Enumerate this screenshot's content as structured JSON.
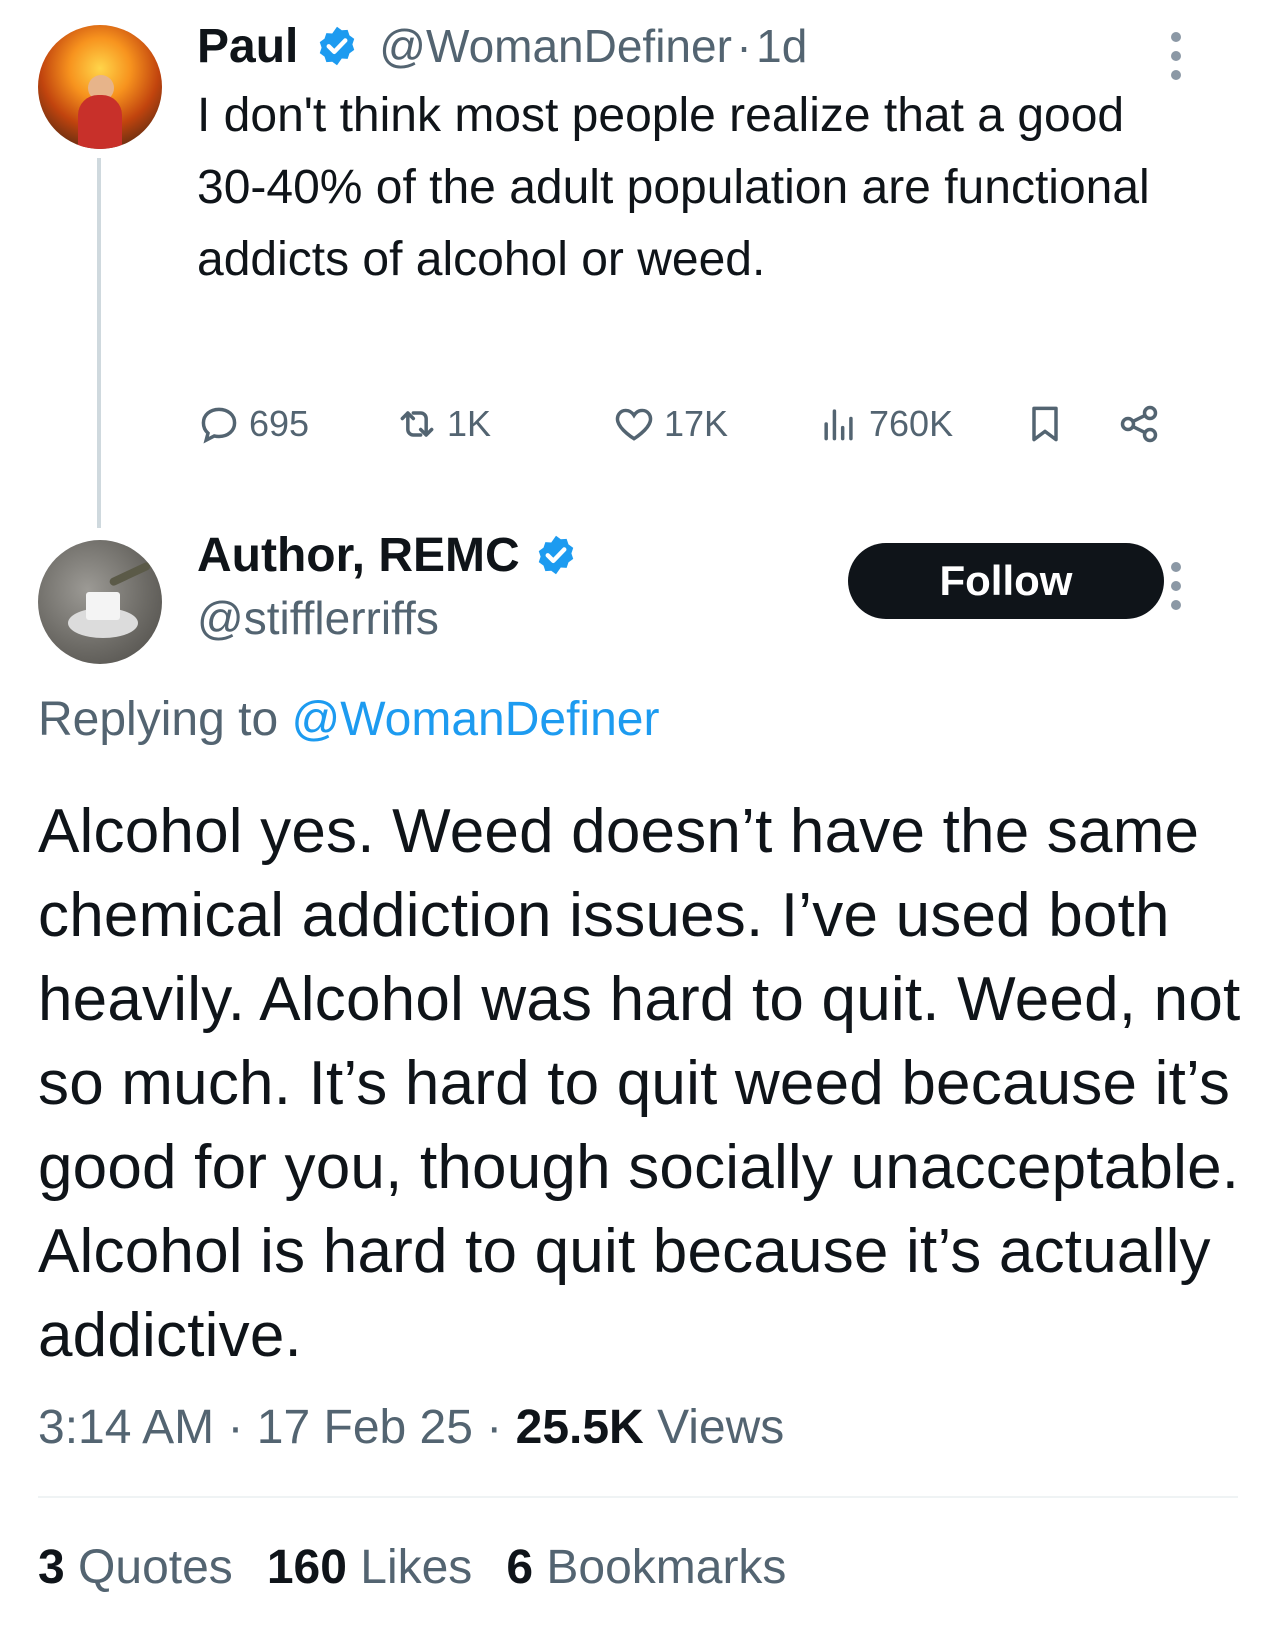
{
  "parent_tweet": {
    "author_name": "Paul",
    "handle": "@WomanDefiner",
    "separator": "·",
    "time_ago": "1d",
    "text": "I don't think most people realize that a good 30-40% of the adult population are functional addicts of alcohol or weed.",
    "actions": {
      "replies": "695",
      "reposts": "1K",
      "likes": "17K",
      "views": "760K"
    }
  },
  "reply_tweet": {
    "author_name": "Author, REMC",
    "handle": "@stifflerriffs",
    "follow_label": "Follow",
    "replying_prefix": "Replying to ",
    "replying_to": "@WomanDefiner",
    "text": "Alcohol yes. Weed doesn’t have the same chemical addiction issues. I’ve used both heavily. Alcohol was hard to quit. Weed, not so much. It’s hard to quit weed because it’s good for you, though socially unacceptable. Alcohol is hard to quit because it’s actually addictive.",
    "time": "3:14 AM",
    "date": "17 Feb 25",
    "sep": "·",
    "views_count": "25.5K",
    "views_label": "Views",
    "stats": {
      "quotes_count": "3",
      "quotes_label": "Quotes",
      "likes_count": "160",
      "likes_label": "Likes",
      "bookmarks_count": "6",
      "bookmarks_label": "Bookmarks"
    }
  },
  "colors": {
    "verified": "#1d9bf0",
    "mention": "#1d9bf0",
    "secondary_text": "#536471",
    "primary_text": "#0f1419",
    "follow_bg": "#0f1419"
  }
}
